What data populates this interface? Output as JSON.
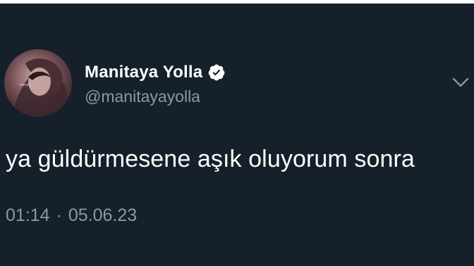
{
  "tweet": {
    "display_name": "Manitaya Yolla",
    "handle": "@manitayayolla",
    "text": "ya güldürmesene aşık oluyorum sonra",
    "time": "01:14",
    "separator": "·",
    "date": "05.06.23"
  },
  "icons": {
    "avatar": "profile-photo",
    "verified": "verified-badge-icon",
    "menu": "chevron-down-icon"
  },
  "colors": {
    "background": "#15202b",
    "text_primary": "#ffffff",
    "text_secondary": "#8899a6"
  }
}
